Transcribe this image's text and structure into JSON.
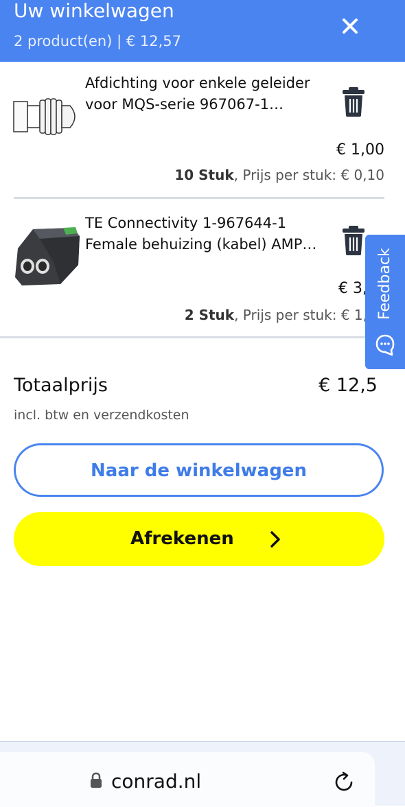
{
  "header": {
    "title": "Uw winkelwagen",
    "subtitle": "2 product(en) | € 12,57",
    "close_icon": "close-icon"
  },
  "items": [
    {
      "name": "Afdichting voor enkele geleider voor MQS-serie 967067-1…",
      "price": "€ 1,00",
      "qty": "10 Stuk",
      "unit_price_text": ", Prijs per stuk: € 0,10",
      "thumb_icon": "seal-product-image",
      "trash_icon": "trash-icon"
    },
    {
      "name": "TE Connectivity 1-967644-1 Female behuizing (kabel) AMP…",
      "price": "€ 3,",
      "qty": "2 Stuk",
      "unit_price_text": ", Prijs per stuk: € 1,",
      "thumb_icon": "connector-housing-product-image",
      "trash_icon": "trash-icon"
    }
  ],
  "totals": {
    "label": "Totaalprijs",
    "value": "€ 12,5",
    "note": "incl. btw en verzendkosten"
  },
  "actions": {
    "cart_button": "Naar de winkelwagen",
    "checkout_button": "Afrekenen",
    "checkout_icon": "chevron-right-icon"
  },
  "feedback": {
    "label": "Feedback",
    "icon": "chat-bubble-icon"
  },
  "browser": {
    "url": "conrad.nl",
    "lock_icon": "lock-icon",
    "reload_icon": "reload-icon"
  },
  "colors": {
    "brand_blue": "#4a84f0",
    "checkout_yellow": "#ffff00",
    "separator": "#d9dde3"
  }
}
